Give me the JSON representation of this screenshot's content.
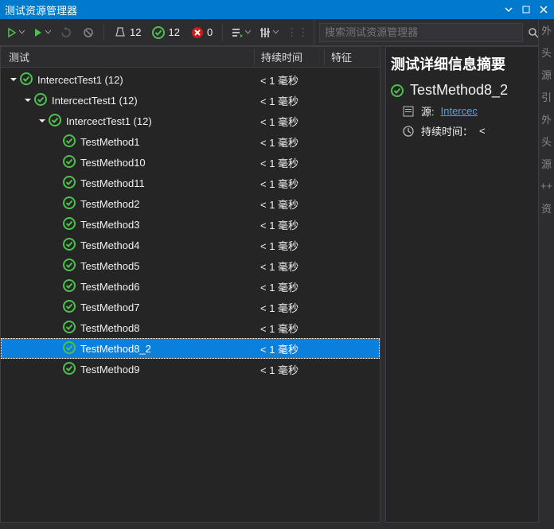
{
  "window": {
    "title": "测试资源管理器"
  },
  "toolbar": {
    "total_count": "12",
    "passed_count": "12",
    "failed_count": "0",
    "search_placeholder": "搜索测试资源管理器"
  },
  "columns": {
    "test": "测试",
    "duration": "持续时间",
    "traits": "特征"
  },
  "tree": [
    {
      "indent": 0,
      "expander": true,
      "name": "IntercectTest1 (12)",
      "duration": "< 1 毫秒",
      "selected": false
    },
    {
      "indent": 1,
      "expander": true,
      "name": "IntercectTest1 (12)",
      "duration": "< 1 毫秒",
      "selected": false
    },
    {
      "indent": 2,
      "expander": true,
      "name": "IntercectTest1 (12)",
      "duration": "< 1 毫秒",
      "selected": false
    },
    {
      "indent": 3,
      "expander": false,
      "name": "TestMethod1",
      "duration": "< 1 毫秒",
      "selected": false
    },
    {
      "indent": 3,
      "expander": false,
      "name": "TestMethod10",
      "duration": "< 1 毫秒",
      "selected": false
    },
    {
      "indent": 3,
      "expander": false,
      "name": "TestMethod11",
      "duration": "< 1 毫秒",
      "selected": false
    },
    {
      "indent": 3,
      "expander": false,
      "name": "TestMethod2",
      "duration": "< 1 毫秒",
      "selected": false
    },
    {
      "indent": 3,
      "expander": false,
      "name": "TestMethod3",
      "duration": "< 1 毫秒",
      "selected": false
    },
    {
      "indent": 3,
      "expander": false,
      "name": "TestMethod4",
      "duration": "< 1 毫秒",
      "selected": false
    },
    {
      "indent": 3,
      "expander": false,
      "name": "TestMethod5",
      "duration": "< 1 毫秒",
      "selected": false
    },
    {
      "indent": 3,
      "expander": false,
      "name": "TestMethod6",
      "duration": "< 1 毫秒",
      "selected": false
    },
    {
      "indent": 3,
      "expander": false,
      "name": "TestMethod7",
      "duration": "< 1 毫秒",
      "selected": false
    },
    {
      "indent": 3,
      "expander": false,
      "name": "TestMethod8",
      "duration": "< 1 毫秒",
      "selected": false
    },
    {
      "indent": 3,
      "expander": false,
      "name": "TestMethod8_2",
      "duration": "< 1 毫秒",
      "selected": true
    },
    {
      "indent": 3,
      "expander": false,
      "name": "TestMethod9",
      "duration": "< 1 毫秒",
      "selected": false
    }
  ],
  "detail": {
    "header": "测试详细信息摘要",
    "test_name": "TestMethod8_2",
    "source_label": "源:",
    "source_link": "Intercec",
    "duration_label": "持续时间：",
    "duration_value": "<"
  },
  "sidebar_stubs": [
    "外",
    "头",
    "源",
    "引",
    "外",
    "头",
    "源",
    "++",
    "资"
  ]
}
